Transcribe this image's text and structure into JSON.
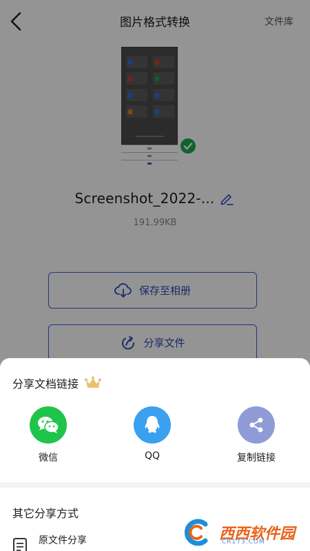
{
  "header": {
    "title": "图片格式转换",
    "library_link": "文件库"
  },
  "file": {
    "name": "Screenshot_2022-...",
    "size": "191.99KB"
  },
  "actions": {
    "save_label": "保存至相册",
    "share_label": "分享文件"
  },
  "share_sheet": {
    "title": "分享文档链接",
    "options": [
      {
        "label": "微信",
        "icon": "wechat-icon",
        "color": "#1fc44a"
      },
      {
        "label": "QQ",
        "icon": "qq-icon",
        "color": "#3aa0f0"
      },
      {
        "label": "复制链接",
        "icon": "share-link-icon",
        "color": "#8f9bd6"
      }
    ],
    "other_title": "其它分享方式",
    "other_options": [
      {
        "label": "原文件分享",
        "icon": "document-icon"
      }
    ]
  },
  "watermark": {
    "brand": "西西软件园",
    "domain": "CR173.COM"
  },
  "colors": {
    "accent": "#3a5bd6",
    "success": "#1eaa52",
    "crown": "#e8c170"
  }
}
